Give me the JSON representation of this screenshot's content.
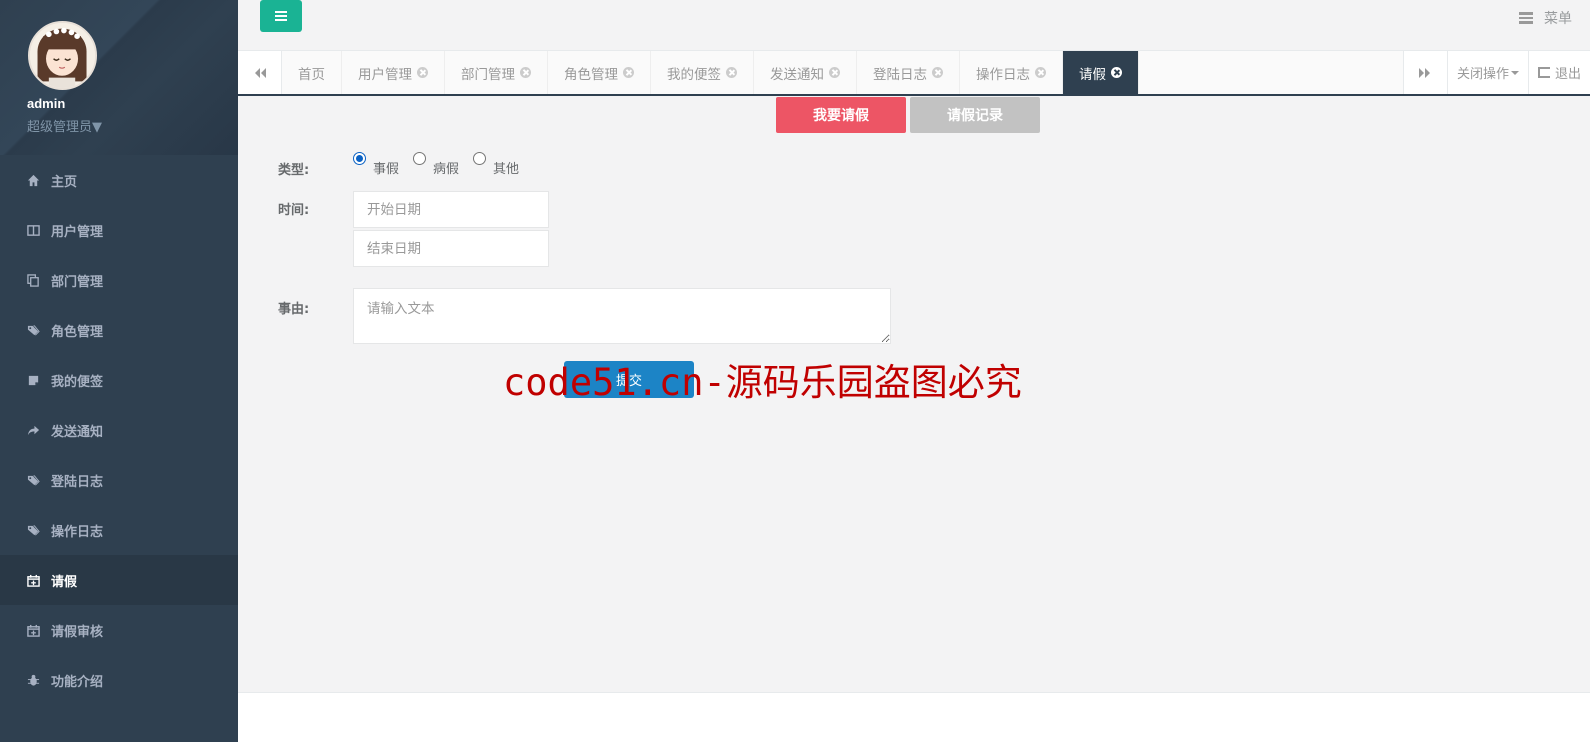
{
  "profile": {
    "name": "admin",
    "role": "超级管理员▼"
  },
  "sidebar": {
    "items": [
      {
        "label": "主页",
        "icon": "home-icon"
      },
      {
        "label": "用户管理",
        "icon": "columns-icon"
      },
      {
        "label": "部门管理",
        "icon": "copy-icon"
      },
      {
        "label": "角色管理",
        "icon": "tags-icon"
      },
      {
        "label": "我的便签",
        "icon": "sticky-note-icon"
      },
      {
        "label": "发送通知",
        "icon": "share-icon"
      },
      {
        "label": "登陆日志",
        "icon": "tags-icon"
      },
      {
        "label": "操作日志",
        "icon": "tags-icon"
      },
      {
        "label": "请假",
        "icon": "calendar-plus-icon",
        "active": true
      },
      {
        "label": "请假审核",
        "icon": "calendar-plus-icon"
      },
      {
        "label": "功能介绍",
        "icon": "bug-icon"
      }
    ]
  },
  "header": {
    "menu_label": "菜单"
  },
  "tabs": [
    {
      "label": "首页",
      "closable": false
    },
    {
      "label": "用户管理",
      "closable": true
    },
    {
      "label": "部门管理",
      "closable": true
    },
    {
      "label": "角色管理",
      "closable": true
    },
    {
      "label": "我的便签",
      "closable": true
    },
    {
      "label": "发送通知",
      "closable": true
    },
    {
      "label": "登陆日志",
      "closable": true
    },
    {
      "label": "操作日志",
      "closable": true
    },
    {
      "label": "请假",
      "closable": true,
      "active": true
    }
  ],
  "tab_actions": {
    "close_ops": "关闭操作",
    "logout": "退出"
  },
  "leave": {
    "btn_request": "我要请假",
    "btn_records": "请假记录",
    "type_label": "类型:",
    "types": [
      {
        "label": "事假",
        "checked": true
      },
      {
        "label": "病假",
        "checked": false
      },
      {
        "label": "其他",
        "checked": false
      }
    ],
    "time_label": "时间:",
    "start_placeholder": "开始日期",
    "end_placeholder": "结束日期",
    "reason_label": "事由:",
    "reason_placeholder": "请输入文本",
    "submit": "提交"
  },
  "watermark": "code51.cn-源码乐园盗图必究",
  "colors": {
    "sidebar": "#2f4050",
    "accent": "#1ab394",
    "danger": "#ed5565",
    "primary": "#1c84c6"
  }
}
